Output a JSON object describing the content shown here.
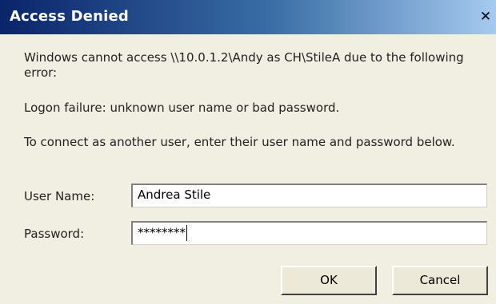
{
  "window": {
    "title": "Access Denied",
    "close_glyph": "✕"
  },
  "messages": {
    "error_intro": "Windows cannot access \\\\10.0.1.2\\Andy as CH\\StileA due to the following error:",
    "error_detail": "Logon failure: unknown user name or bad password.",
    "instruction": "To connect as another user, enter their user name and password below."
  },
  "form": {
    "username_label": "User Name:",
    "username_value": "Andrea Stile",
    "password_label": "Password:",
    "password_value": "********"
  },
  "buttons": {
    "ok_label": "OK",
    "cancel_label": "Cancel"
  }
}
